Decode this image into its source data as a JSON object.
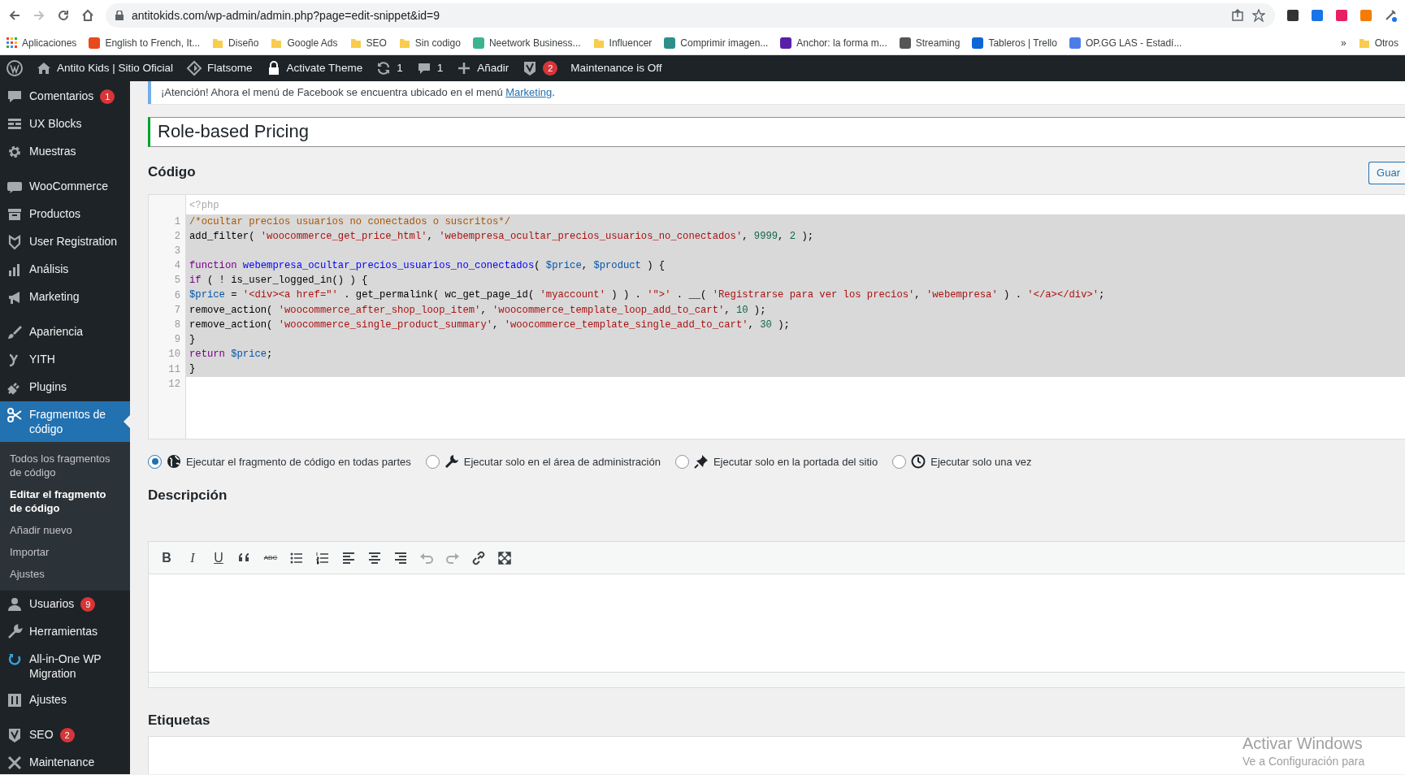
{
  "browser": {
    "address": "antitokids.com/wp-admin/admin.php?page=edit-snippet&id=9",
    "bookmarks": [
      {
        "kind": "apps",
        "label": "Aplicaciones"
      },
      {
        "kind": "site",
        "color": "#e8491d",
        "label": "English to French, It..."
      },
      {
        "kind": "folder",
        "label": "Diseño"
      },
      {
        "kind": "folder",
        "label": "Google Ads"
      },
      {
        "kind": "folder",
        "label": "SEO"
      },
      {
        "kind": "folder",
        "label": "Sin codigo"
      },
      {
        "kind": "site",
        "color": "#3bb58f",
        "label": "Neetwork Business..."
      },
      {
        "kind": "folder",
        "label": "Influencer"
      },
      {
        "kind": "site",
        "color": "#2e8f8a",
        "label": "Comprimir imagen..."
      },
      {
        "kind": "site",
        "color": "#5a1fa8",
        "label": "Anchor: la forma m..."
      },
      {
        "kind": "site",
        "color": "#555555",
        "label": "Streaming"
      },
      {
        "kind": "site",
        "color": "#0c66d6",
        "label": "Tableros | Trello"
      },
      {
        "kind": "site",
        "color": "#4d7ce8",
        "label": "OP.GG LAS - Estadí..."
      }
    ],
    "overflow": "»",
    "other_folder": "Otros"
  },
  "admin_bar": {
    "items": [
      {
        "label": "Antito Kids | Sitio Oficial"
      },
      {
        "label": "Flatsome"
      },
      {
        "label": "Activate Theme"
      },
      {
        "label": "1"
      },
      {
        "label": "1"
      },
      {
        "label": "Añadir"
      },
      {
        "badge": "2"
      },
      {
        "label": "Maintenance is Off"
      }
    ]
  },
  "sidebar": {
    "groups": [
      [
        {
          "label": "Comentarios",
          "badge": "1",
          "selected": false
        },
        {
          "label": "UX Blocks",
          "selected": false
        },
        {
          "label": "Muestras",
          "selected": false
        }
      ],
      [
        {
          "label": "WooCommerce",
          "selected": false
        },
        {
          "label": "Productos",
          "selected": false
        },
        {
          "label": "User Registration",
          "selected": false
        },
        {
          "label": "Análisis",
          "selected": false
        },
        {
          "label": "Marketing",
          "selected": false
        }
      ],
      [
        {
          "label": "Apariencia",
          "selected": false
        },
        {
          "label": "YITH",
          "selected": false
        },
        {
          "label": "Plugins",
          "selected": false
        },
        {
          "label": "Fragmentos de código",
          "selected": true,
          "children": [
            {
              "label": "Todos los fragmentos de código",
              "selected": false
            },
            {
              "label": "Editar el fragmento de código",
              "selected": true
            },
            {
              "label": "Añadir nuevo",
              "selected": false
            },
            {
              "label": "Importar",
              "selected": false
            },
            {
              "label": "Ajustes",
              "selected": false
            }
          ]
        },
        {
          "label": "Usuarios",
          "badge": "9",
          "selected": false
        },
        {
          "label": "Herramientas",
          "selected": false
        },
        {
          "label": "All-in-One WP Migration",
          "selected": false
        },
        {
          "label": "Ajustes",
          "selected": false
        }
      ],
      [
        {
          "label": "SEO",
          "badge": "2",
          "selected": false
        },
        {
          "label": "Maintenance",
          "selected": false
        }
      ]
    ]
  },
  "notice": {
    "text": "¡Atención! Ahora el menú de Facebook se encuentra ubicado en el menú ",
    "link": "Marketing",
    "after": "."
  },
  "title_field": {
    "value": "Role-based Pricing"
  },
  "code_section": {
    "heading": "Código",
    "save_button": "Guar",
    "editor": {
      "header": "<?php",
      "lines": [
        {
          "number": "1",
          "selected": true,
          "tokens": [
            {
              "kind": "comment",
              "text": "/*ocultar precios usuarios no conectados o suscritos*/"
            }
          ]
        },
        {
          "number": "2",
          "selected": true,
          "tokens": [
            {
              "kind": "plain",
              "text": "add_filter( "
            },
            {
              "kind": "string",
              "text": "'woocommerce_get_price_html'"
            },
            {
              "kind": "plain",
              "text": ", "
            },
            {
              "kind": "string",
              "text": "'webempresa_ocultar_precios_usuarios_no_conectados'"
            },
            {
              "kind": "plain",
              "text": ", "
            },
            {
              "kind": "number",
              "text": "9999"
            },
            {
              "kind": "plain",
              "text": ", "
            },
            {
              "kind": "number",
              "text": "2"
            },
            {
              "kind": "plain",
              "text": " );"
            }
          ]
        },
        {
          "number": "3",
          "selected": true
        },
        {
          "number": "4",
          "selected": true,
          "tokens": [
            {
              "kind": "keyword",
              "text": "function"
            },
            {
              "kind": "def",
              "text": " webempresa_ocultar_precios_usuarios_no_conectados"
            },
            {
              "kind": "plain",
              "text": "( "
            },
            {
              "kind": "variable",
              "text": "$price"
            },
            {
              "kind": "plain",
              "text": ", "
            },
            {
              "kind": "variable",
              "text": "$product"
            },
            {
              "kind": "plain",
              "text": " ) {"
            }
          ]
        },
        {
          "number": "5",
          "selected": true,
          "tokens": [
            {
              "kind": "keyword",
              "text": "if"
            },
            {
              "kind": "plain",
              "text": " ( ! is_user_logged_in() ) {"
            }
          ]
        },
        {
          "number": "6",
          "selected": true,
          "tokens": [
            {
              "kind": "variable",
              "text": "$price"
            },
            {
              "kind": "plain",
              "text": " = "
            },
            {
              "kind": "string",
              "text": "'<div><a href=\"'"
            },
            {
              "kind": "plain",
              "text": " . get_permalink( wc_get_page_id( "
            },
            {
              "kind": "string",
              "text": "'myaccount'"
            },
            {
              "kind": "plain",
              "text": " ) ) . "
            },
            {
              "kind": "string",
              "text": "'\">'"
            },
            {
              "kind": "plain",
              "text": " . __( "
            },
            {
              "kind": "string",
              "text": "'Registrarse para ver los precios'"
            },
            {
              "kind": "plain",
              "text": ", "
            },
            {
              "kind": "string",
              "text": "'webempresa'"
            },
            {
              "kind": "plain",
              "text": " ) . "
            },
            {
              "kind": "string",
              "text": "'</a></div>'"
            },
            {
              "kind": "plain",
              "text": ";"
            }
          ]
        },
        {
          "number": "7",
          "selected": true,
          "tokens": [
            {
              "kind": "plain",
              "text": "remove_action( "
            },
            {
              "kind": "string",
              "text": "'woocommerce_after_shop_loop_item'"
            },
            {
              "kind": "plain",
              "text": ", "
            },
            {
              "kind": "string",
              "text": "'woocommerce_template_loop_add_to_cart'"
            },
            {
              "kind": "plain",
              "text": ", "
            },
            {
              "kind": "number",
              "text": "10"
            },
            {
              "kind": "plain",
              "text": " );"
            }
          ]
        },
        {
          "number": "8",
          "selected": true,
          "tokens": [
            {
              "kind": "plain",
              "text": "remove_action( "
            },
            {
              "kind": "string",
              "text": "'woocommerce_single_product_summary'"
            },
            {
              "kind": "plain",
              "text": ", "
            },
            {
              "kind": "string",
              "text": "'woocommerce_template_single_add_to_cart'"
            },
            {
              "kind": "plain",
              "text": ", "
            },
            {
              "kind": "number",
              "text": "30"
            },
            {
              "kind": "plain",
              "text": " );"
            }
          ]
        },
        {
          "number": "9",
          "selected": true,
          "tokens": [
            {
              "kind": "plain",
              "text": "}"
            }
          ]
        },
        {
          "number": "10",
          "selected": true,
          "tokens": [
            {
              "kind": "keyword",
              "text": "return"
            },
            {
              "kind": "variable",
              "text": " $price"
            },
            {
              "kind": "plain",
              "text": ";"
            }
          ]
        },
        {
          "number": "11",
          "selected": true,
          "tokens": [
            {
              "kind": "plain",
              "text": "}"
            }
          ]
        },
        {
          "number": "12",
          "selected": false
        }
      ]
    }
  },
  "scope_options": [
    {
      "label": "Ejecutar el fragmento de código en todas partes",
      "selected": true
    },
    {
      "label": "Ejecutar solo en el área de administración",
      "selected": false
    },
    {
      "label": "Ejecutar solo en la portada del sitio",
      "selected": false
    },
    {
      "label": "Ejecutar solo una vez",
      "selected": false
    }
  ],
  "description": {
    "heading": "Descripción",
    "toolbar": [
      {
        "kind": "text",
        "label": "B",
        "disabled": false
      },
      {
        "kind": "text",
        "label": "I",
        "disabled": false
      },
      {
        "kind": "text",
        "label": "U",
        "disabled": false
      },
      {
        "kind": "icon",
        "disabled": false
      },
      {
        "kind": "text",
        "label": "ABC",
        "disabled": false
      },
      {
        "kind": "icon",
        "disabled": false
      },
      {
        "kind": "icon",
        "disabled": false
      },
      {
        "kind": "icon",
        "disabled": false
      },
      {
        "kind": "icon",
        "disabled": false
      },
      {
        "kind": "icon",
        "disabled": false
      },
      {
        "kind": "icon",
        "disabled": true
      },
      {
        "kind": "icon",
        "disabled": true
      },
      {
        "kind": "icon",
        "disabled": false
      },
      {
        "kind": "icon",
        "disabled": false
      }
    ]
  },
  "tags": {
    "heading": "Etiquetas"
  },
  "os_watermark": {
    "title": "Activar Windows",
    "subtitle": "Ve a Configuración para"
  }
}
